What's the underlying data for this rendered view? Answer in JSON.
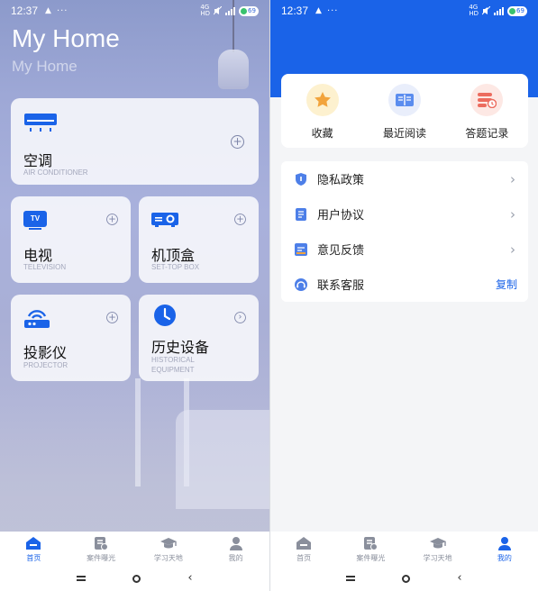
{
  "status_left": {
    "time": "12:37",
    "lead": "▲",
    "dots": "···",
    "battery": "69"
  },
  "status_right": {
    "time": "12:37",
    "lead": "▲",
    "dots": "···",
    "battery": "69"
  },
  "home": {
    "title": "My Home",
    "subtitle": "My Home"
  },
  "devices": [
    {
      "cn": "空调",
      "en": "AIR CONDITIONER",
      "icon": "air-conditioner-icon"
    },
    {
      "cn": "电视",
      "en": "TELEVISION",
      "icon": "tv-icon",
      "icon_text": "TV"
    },
    {
      "cn": "机顶盒",
      "en": "SET-TOP BOX",
      "icon": "set-top-box-icon"
    },
    {
      "cn": "投影仪",
      "en": "PROJECTOR",
      "icon": "projector-icon"
    },
    {
      "cn": "历史设备",
      "en_line1": "HISTORICAL",
      "en_line2": "EQUIPMENT",
      "icon": "clock-icon"
    }
  ],
  "nav": [
    {
      "label": "首页",
      "icon": "home-icon"
    },
    {
      "label": "案件曝光",
      "icon": "case-exposure-icon"
    },
    {
      "label": "学习天地",
      "icon": "graduation-cap-icon"
    },
    {
      "label": "我的",
      "icon": "user-icon"
    }
  ],
  "nav_active": {
    "left": "首页",
    "right": "我的"
  },
  "favorites": [
    {
      "label": "收藏",
      "icon": "star-icon"
    },
    {
      "label": "最近阅读",
      "icon": "book-icon"
    },
    {
      "label": "答题记录",
      "icon": "quiz-record-icon"
    }
  ],
  "menu": [
    {
      "label": "隐私政策",
      "icon": "shield-icon",
      "action": "›"
    },
    {
      "label": "用户协议",
      "icon": "document-icon",
      "action": "›"
    },
    {
      "label": "意见反馈",
      "icon": "feedback-icon",
      "action": "›"
    },
    {
      "label": "联系客服",
      "icon": "headset-icon",
      "action": "复制"
    }
  ],
  "colors": {
    "primary": "#1a63e8",
    "nav_inactive": "#8a8f9c",
    "star_bg": "#fdf1cf",
    "star": "#f2a43c",
    "book_bg": "#e9eefb",
    "record_bg": "#fde8e4",
    "record": "#ec6b5e"
  }
}
